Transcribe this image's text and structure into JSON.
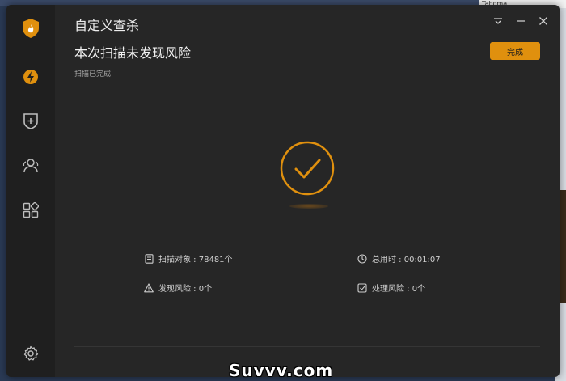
{
  "background": {
    "font_label": "Tahoma"
  },
  "window": {
    "title": "自定义查杀",
    "controls": [
      "menu-icon",
      "minimize-icon",
      "close-icon"
    ]
  },
  "sidebar": {
    "items": [
      {
        "name": "logo",
        "icon": "shield-flame-icon"
      },
      {
        "name": "boost",
        "icon": "lightning-icon",
        "active": true
      },
      {
        "name": "protect",
        "icon": "shield-plus-icon"
      },
      {
        "name": "users",
        "icon": "users-icon"
      },
      {
        "name": "apps",
        "icon": "apps-grid-icon"
      },
      {
        "name": "settings",
        "icon": "gear-icon"
      }
    ]
  },
  "result": {
    "headline": "本次扫描未发现风险",
    "subline": "扫描已完成",
    "done_button": "完成",
    "status_icon": "check-circle-icon"
  },
  "stats": {
    "scanned": "扫描对象 : 78481个",
    "elapsed": "总用时 : 00:01:07",
    "found": "发现风险 : 0个",
    "handled": "处理风险 : 0个"
  },
  "watermark": "Suvvv.com",
  "colors": {
    "accent": "#e0900e",
    "window_bg": "#262626",
    "sidebar_bg": "#1f1f1f",
    "text": "#ededed",
    "muted_text": "#a9a9a9"
  }
}
